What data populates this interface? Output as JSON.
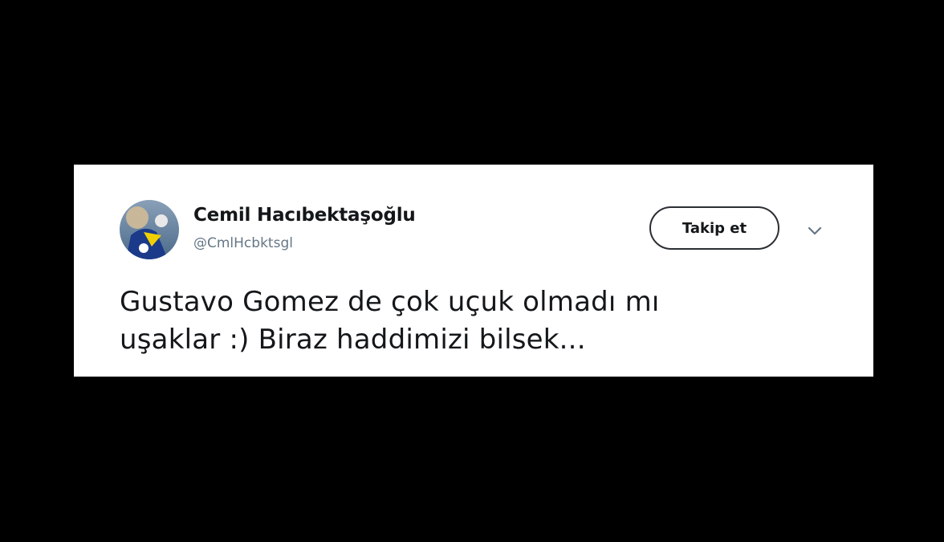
{
  "tweet": {
    "display_name": "Cemil Hacıbektaşoğlu",
    "handle": "@CmlHcbktsgl",
    "follow_label": "Takip et",
    "text_lines": [
      "Gustavo Gomez de çok uçuk olmadı mı",
      "uşaklar :) Biraz haddimizi bilsek..."
    ]
  },
  "icons": {
    "avatar": "profile-photo",
    "menu": "chevron-down-icon"
  },
  "colors": {
    "page_background": "#000000",
    "card_background": "#ffffff",
    "text": "#14171a",
    "secondary_text": "#657786"
  }
}
